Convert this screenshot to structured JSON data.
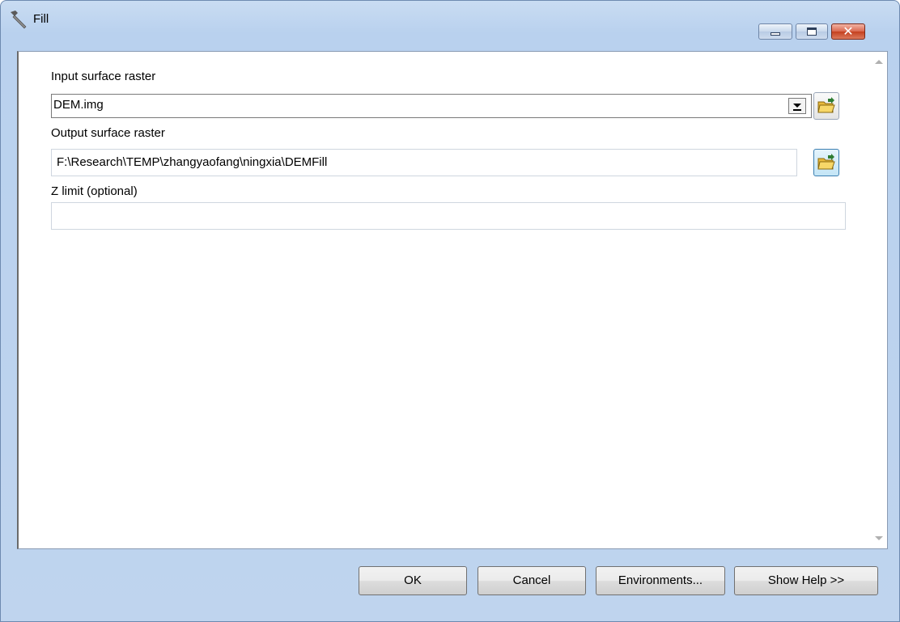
{
  "window": {
    "title": "Fill",
    "icon": "hammer-icon"
  },
  "form": {
    "input_label": "Input surface raster",
    "input_value": "DEM.img",
    "output_label": "Output surface raster",
    "output_value": "F:\\Research\\TEMP\\zhangyaofang\\ningxia\\DEMFill",
    "zlimit_label": "Z limit (optional)",
    "zlimit_value": ""
  },
  "buttons": {
    "ok": "OK",
    "cancel": "Cancel",
    "environments": "Environments...",
    "show_help": "Show Help >>"
  }
}
